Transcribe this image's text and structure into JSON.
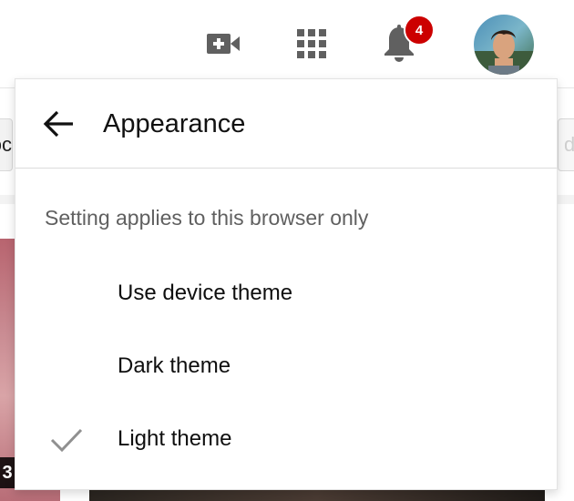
{
  "masthead": {
    "notification_count": "4",
    "icons": [
      "video-create-icon",
      "apps-grid-icon",
      "bell-icon"
    ],
    "badge_color": "#cc0000"
  },
  "background": {
    "left_chip_text": "oc",
    "right_chip_text": "d",
    "thumbnail_time_fragment": "3"
  },
  "menu": {
    "title": "Appearance",
    "note": "Setting applies to this browser only",
    "items": [
      {
        "label": "Use device theme",
        "selected": false
      },
      {
        "label": "Dark theme",
        "selected": false
      },
      {
        "label": "Light theme",
        "selected": true
      }
    ],
    "check_color": "#909090"
  }
}
